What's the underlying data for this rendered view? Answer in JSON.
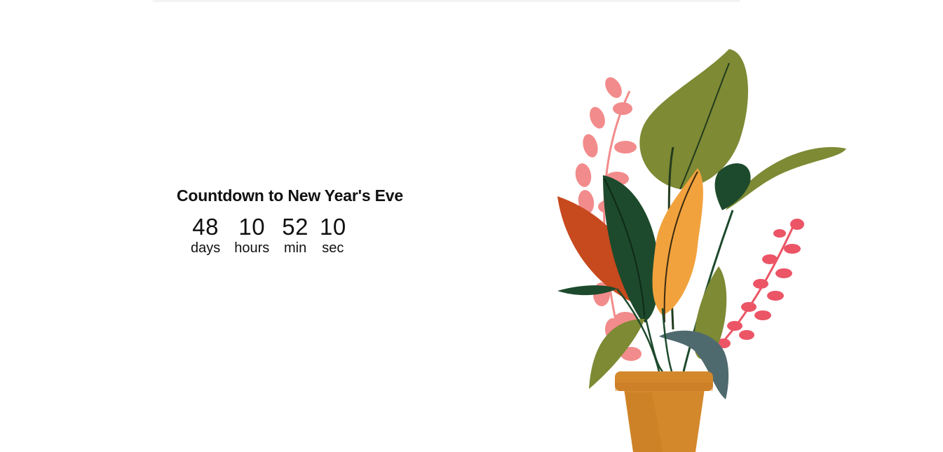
{
  "countdown": {
    "title": "Countdown to New Year's Eve",
    "units": [
      {
        "value": "48",
        "label": "days"
      },
      {
        "value": "10",
        "label": "hours"
      },
      {
        "value": "52",
        "label": "min"
      },
      {
        "value": "10",
        "label": "sec"
      }
    ]
  },
  "illustration": {
    "icon": "potted-plant-illustration",
    "colors": {
      "leaf_green": "#7e8a34",
      "dark_green": "#1d4a2c",
      "orange_leaf": "#f1a23d",
      "red_leaf": "#c7491e",
      "pink_fern": "#f28b8b",
      "red_fern": "#eb5566",
      "slate_leaf": "#4f6a6e",
      "pot": "#d4882c"
    }
  }
}
